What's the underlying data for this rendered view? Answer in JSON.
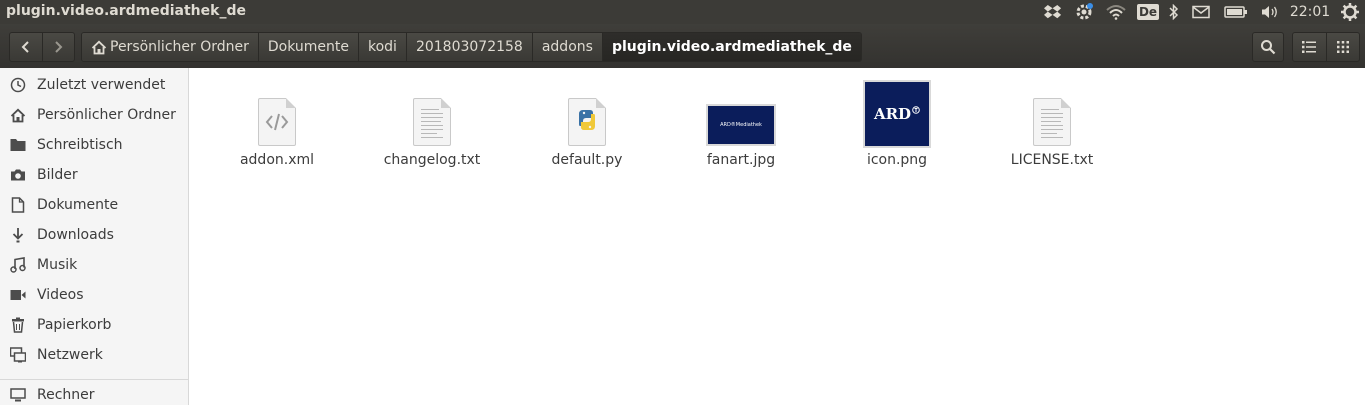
{
  "window": {
    "title": "plugin.video.ardmediathek_de"
  },
  "panel": {
    "keyboard_layout": "De",
    "clock": "22:01",
    "icons": [
      "dropbox-icon",
      "settings-update-icon",
      "wifi-icon",
      "keyboard-icon",
      "bluetooth-icon",
      "mail-icon",
      "battery-icon",
      "volume-icon",
      "clock",
      "power-gear-icon"
    ]
  },
  "toolbar": {
    "back": "back-icon",
    "forward": "forward-icon",
    "breadcrumbs": [
      {
        "label": "Persönlicher Ordner",
        "icon": "home-icon"
      },
      {
        "label": "Dokumente"
      },
      {
        "label": "kodi"
      },
      {
        "label": "201803072158"
      },
      {
        "label": "addons"
      },
      {
        "label": "plugin.video.ardmediathek_de"
      }
    ],
    "search": "search-icon",
    "views": [
      "list-view-icon",
      "grid-view-icon"
    ]
  },
  "sidebar": {
    "items": [
      {
        "label": "Zuletzt verwendet",
        "icon": "recent-clock-icon"
      },
      {
        "label": "Persönlicher Ordner",
        "icon": "home-icon"
      },
      {
        "label": "Schreibtisch",
        "icon": "folder-icon"
      },
      {
        "label": "Bilder",
        "icon": "camera-icon"
      },
      {
        "label": "Dokumente",
        "icon": "document-icon"
      },
      {
        "label": "Downloads",
        "icon": "download-icon"
      },
      {
        "label": "Musik",
        "icon": "music-icon"
      },
      {
        "label": "Videos",
        "icon": "video-icon"
      },
      {
        "label": "Papierkorb",
        "icon": "trash-icon"
      },
      {
        "label": "Netzwerk",
        "icon": "network-icon"
      },
      {
        "label": "Rechner",
        "icon": "computer-icon"
      }
    ]
  },
  "files": [
    {
      "name": "addon.xml",
      "icon": "xml-file-icon"
    },
    {
      "name": "changelog.txt",
      "icon": "text-file-icon"
    },
    {
      "name": "default.py",
      "icon": "python-file-icon"
    },
    {
      "name": "fanart.jpg",
      "icon": "image-thumbnail",
      "thumb_text": "ARD®Mediathek"
    },
    {
      "name": "icon.png",
      "icon": "image-thumbnail",
      "thumb_text": "ARD"
    },
    {
      "name": "LICENSE.txt",
      "icon": "text-file-icon"
    }
  ],
  "colors": {
    "panel": "#3c3b37",
    "ard_blue": "#0b1d5b",
    "sidebar": "#f5f5f5"
  }
}
